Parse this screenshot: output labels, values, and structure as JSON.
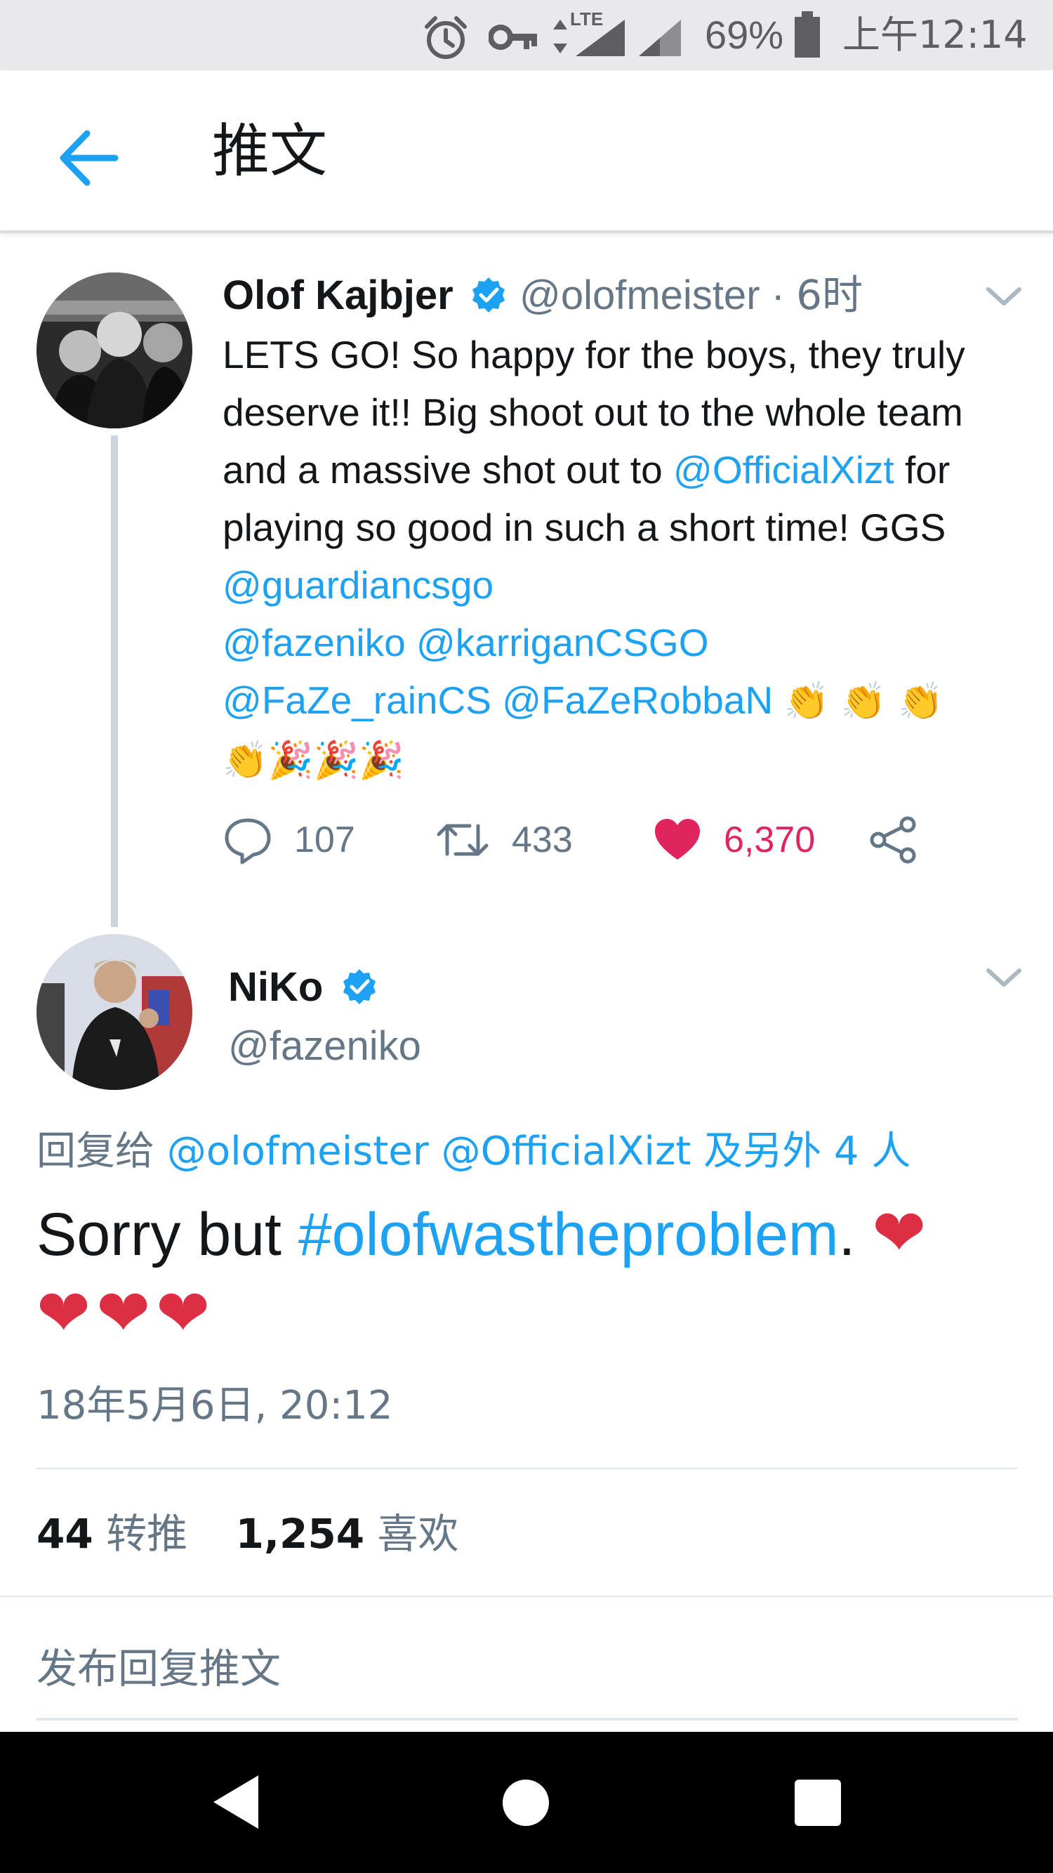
{
  "status_bar": {
    "battery": "69%",
    "time": "上午12:14",
    "network": "LTE",
    "icons": [
      "alarm-icon",
      "key-icon",
      "signal-icon",
      "battery-icon"
    ]
  },
  "header": {
    "title": "推文",
    "back_icon": "arrow-left-icon"
  },
  "tweet1": {
    "name": "Olof Kajbjer",
    "handle": "@olofmeister",
    "separator": " · ",
    "time_ago": "6时",
    "verified": true,
    "text_parts": {
      "p1": "LETS GO! So happy for the boys, they truly deserve it!! Big shoot out to the whole team and a massive shot out to ",
      "m1": "@OfficialXizt",
      "p2": " for playing so good in such a short time! GGS ",
      "m2": "@guardiancsgo",
      "m3": "@fazeniko",
      "m4": "@karriganCSGO",
      "m5": "@FaZe_rainCS",
      "m6": "@FaZeRobbaN",
      "emoji_line1": "👏 👏 👏",
      "emoji_line2": "👏🎉🎉🎉"
    },
    "actions": {
      "replies": "107",
      "retweets": "433",
      "likes": "6,370"
    }
  },
  "tweet2": {
    "name": "NiKo",
    "handle": "@fazeniko",
    "verified": true,
    "reply_prefix": "回复给 ",
    "reply_mentions": "@olofmeister @OfficialXizt 及另外 4 人",
    "text_before": "Sorry but ",
    "hashtag": "#olofwastheproblem",
    "text_after": ". ",
    "hearts_line1": "❤",
    "hearts_line2": "❤❤❤",
    "timestamp": "18年5月6日, 20:12",
    "retweet_count": "44",
    "retweet_label": "转推",
    "like_count": "1,254",
    "like_label": "喜欢"
  },
  "reply_box": {
    "placeholder": "发布回复推文"
  },
  "colors": {
    "accent": "#1da1f2",
    "like": "#e0245e",
    "muted": "#657786",
    "heart_emoji": "#dd2e44"
  }
}
